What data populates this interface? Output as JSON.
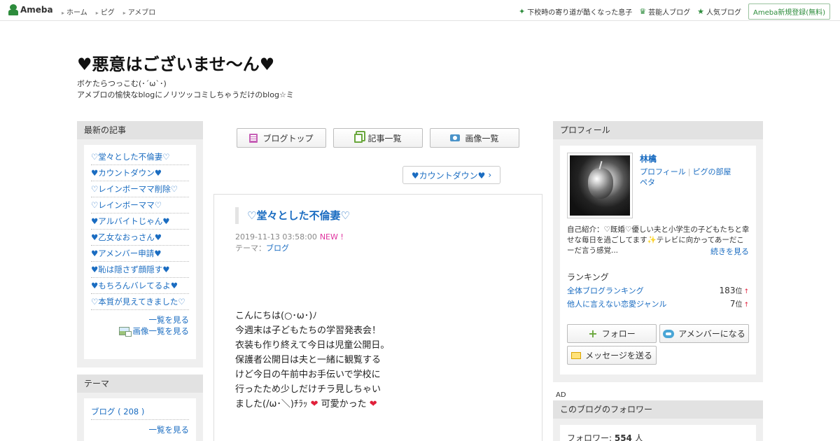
{
  "topbar": {
    "logo_text": "Ameba",
    "nav": [
      "ホーム",
      "ピグ",
      "アメブロ"
    ],
    "right_links": [
      {
        "label": "下校時の寄り道が酷くなった息子",
        "icon": "clover-icon"
      },
      {
        "label": "芸能人ブログ",
        "icon": "crown-icon"
      },
      {
        "label": "人気ブログ",
        "icon": "star-icon"
      }
    ],
    "register": "Ameba新規登録(無料)"
  },
  "header": {
    "title": "♥悪意はございませ～ん♥",
    "desc_line1": "ボケたらつっこむ(･´ω`･)",
    "desc_line2": "アメブロの愉快なblogにノリツッコミしちゃうだけのblog☆ミ"
  },
  "recent": {
    "heading": "最新の記事",
    "items": [
      "♡堂々とした不倫妻♡",
      "♥カウントダウン♥",
      "♡レインボーママ削除♡",
      "♡レインボーママ♡",
      "♥アルバイトじゃん♥",
      "♥乙女なおっさん♥",
      "♥アメンバー申請♥",
      "♥恥は隠さず顔隠す♥",
      "♥もちろんバレてるよ♥",
      "♡本質が見えてきました♡"
    ],
    "more": "一覧を見る",
    "image_list": "画像一覧を見る"
  },
  "theme_box": {
    "heading": "テーマ",
    "items": [
      "ブログ ( 208 )"
    ],
    "more": "一覧を見る"
  },
  "center_nav": {
    "blog_top": "ブログトップ",
    "article_list": "記事一覧",
    "image_list": "画像一覧"
  },
  "next_article": "♥カウントダウン♥",
  "article": {
    "title": "♡堂々とした不倫妻♡",
    "datetime": "2019-11-13 03:58:00",
    "new_badge": "NEW !",
    "theme_label": "テーマ：",
    "theme_value": "ブログ",
    "body": [
      "こんにちは(○･ω･)ﾉ",
      "今週末は子どもたちの学習発表会！",
      "衣装も作り終えて今日は児童公開日。",
      "保護者公開日は夫と一緒に観覧する",
      "けど今日の午前中お手伝いで学校に",
      "行ったため少しだけチラ見しちゃい",
      "ました(/ω･＼)ﾁﾗｯ",
      "可愛かった"
    ],
    "heart": "❤"
  },
  "profile": {
    "heading": "プロフィール",
    "name": "林檎",
    "link_profile": "プロフィール",
    "link_pig_room": "ピグの部屋",
    "link_peta": "ペタ",
    "intro": "自己紹介：♡既婚♡優しい夫と小学生の子どもたちと幸せな毎日を過ごしてます✨テレビに向かってあーだこーだ言う感覚...",
    "read_more": "続きを見る",
    "ranking_heading": "ランキング",
    "rankings": [
      {
        "label": "全体ブログランキング",
        "value": "183",
        "unit": "位",
        "trend": "↑"
      },
      {
        "label": "他人に言えない恋愛ジャンル",
        "value": "7",
        "unit": "位",
        "trend": "↑"
      }
    ],
    "follow": "フォロー",
    "amember": "アメンバーになる",
    "message": "メッセージを送る"
  },
  "ad_label": "AD",
  "followers": {
    "heading": "このブログのフォロワー",
    "label": "フォロワー: ",
    "count": "554",
    "unit": " 人"
  }
}
